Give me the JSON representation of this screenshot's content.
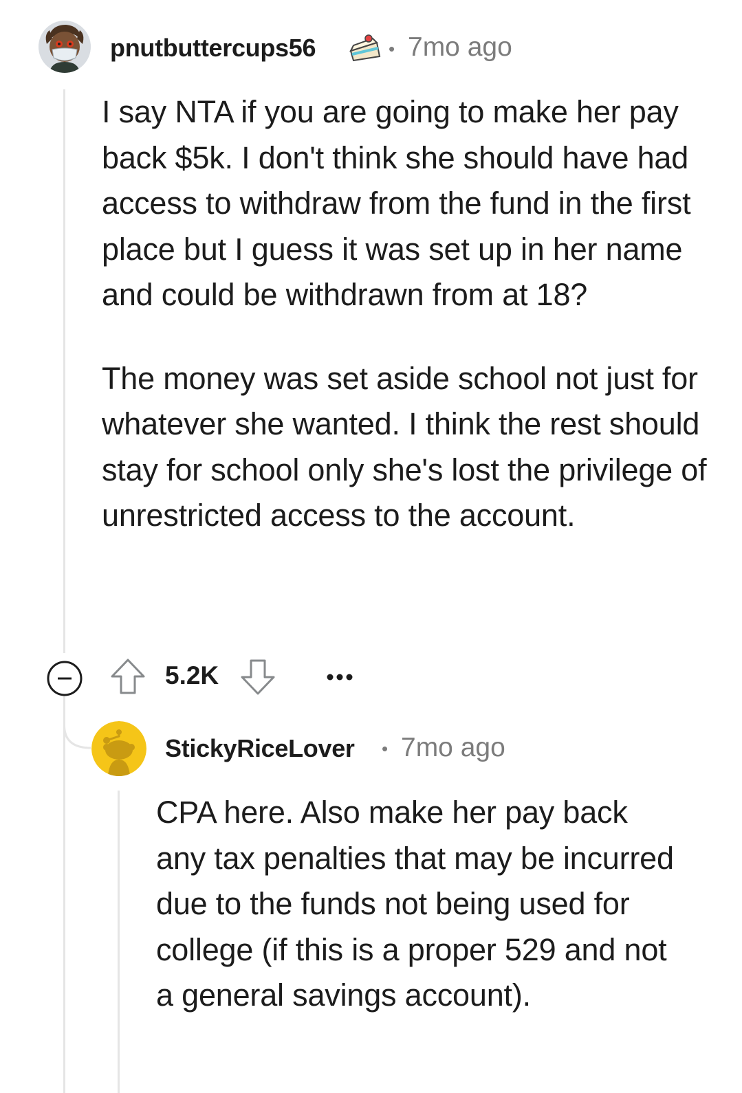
{
  "comments": [
    {
      "author": "pnutbuttercups56",
      "separator": "•",
      "time": "7mo ago",
      "badge_icon": "cake-icon",
      "body": [
        "I say NTA if you are going to make her pay back $5k. I don't think she should have had access to withdraw from the fund in the first place but I guess it was set up in her name and could be withdrawn from at 18?",
        "The money was set aside school not just for whatever she wanted. I think the rest should stay for school only she's lost the privilege of unrestricted access to the account."
      ],
      "votes": "5.2K",
      "collapse_icon": "collapse-minus-icon",
      "upvote_icon": "upvote-arrow-icon",
      "downvote_icon": "downvote-arrow-icon",
      "more_icon": "more-options-icon"
    },
    {
      "author": "StickyRiceLover",
      "separator": "•",
      "time": "7mo ago",
      "body": [
        "CPA here. Also make her pay back any tax penalties that may be incurred due to the funds not being used for college (if this is a proper 529 and not a general savings account)."
      ]
    }
  ],
  "colors": {
    "text": "#1c1c1c",
    "meta": "#7c7c7c",
    "thread_line": "#e5e5e5",
    "snoo_avatar_bg": "#f5c518"
  }
}
